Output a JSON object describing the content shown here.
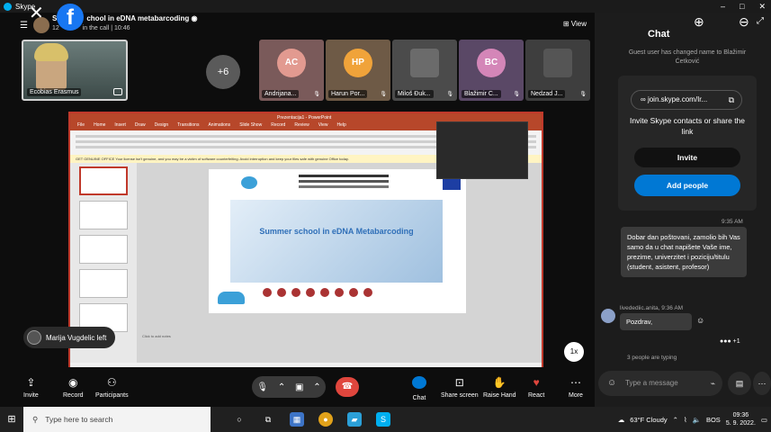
{
  "window": {
    "app_name": "Skype",
    "minimize": "–",
    "maximize": "□",
    "close": "✕"
  },
  "call": {
    "title": "Summer school in eDNA metabarcoding",
    "title_left": "S",
    "title_right": "chool in eDNA metabarcoding",
    "subtitle_left": "12 ",
    "subtitle_right": " in the call | 10:46",
    "view_label": "View",
    "view_icon": "grid-icon"
  },
  "participants": {
    "self_label": "Ecobias Erasmus",
    "more_count": "+6",
    "tiles": [
      {
        "initials": "AC",
        "name": "Andrijana...",
        "color": "#e29a90",
        "bg": "#7a5a5a"
      },
      {
        "initials": "HP",
        "name": "Harun Por...",
        "color": "#f0a33a",
        "bg": "#6e5a46"
      },
      {
        "initials": "",
        "name": "Miloš Đuk...",
        "color": "#6b6b6b",
        "bg": "#4b4b4b"
      },
      {
        "initials": "BC",
        "name": "Blažimir C...",
        "color": "#d486b8",
        "bg": "#5a4866"
      },
      {
        "initials": "",
        "name": "Nedzad J...",
        "color": "#555",
        "bg": "#3e3e3e"
      }
    ]
  },
  "share": {
    "ppt_title": "Prezentacija1 - PowerPoint",
    "ribbon_tabs": [
      "File",
      "Home",
      "Insert",
      "Draw",
      "Design",
      "Transitions",
      "Animations",
      "Slide Show",
      "Record",
      "Review",
      "View",
      "Help"
    ],
    "warning": "GET GENUINE OFFICE  Your license isn't genuine, and you may be a victim of software counterfeiting. Avoid interruption and keep your files safe with genuine Office today.",
    "slide_title": "Summer school in eDNA Metabarcoding",
    "notes": "Click to add notes"
  },
  "notification": {
    "text": "Marija Vugdelic left"
  },
  "speed_badge": "1x",
  "callbar": {
    "invite": "Invite",
    "record": "Record",
    "participants": "Participants",
    "chat": "Chat",
    "share_screen": "Share screen",
    "raise_hand": "Raise Hand",
    "react": "React",
    "more": "More"
  },
  "chat": {
    "title": "Chat",
    "system_message": "Guest user has changed name to Blažimir Ćetković",
    "link": "join.skype.com/Ir...",
    "invite_text": "Invite Skype contacts or share the link",
    "invite_button": "Invite",
    "add_people_button": "Add people",
    "msg1_time": "9:35 AM",
    "msg1_text": "Dobar dan poštovani, zamolio bih Vas samo da u chat napišete Vaše ime, prezime, univerzitet i poziciju/titulu (student, asistent, profesor)",
    "msg2_sender": "livedediic.anita, 9:36 AM",
    "msg2_text": "Pozdrav,",
    "reacts_count": "+1",
    "typing": "3 people are typing",
    "input_placeholder": "Type a message"
  },
  "taskbar": {
    "search_placeholder": "Type here to search",
    "weather": "63°F  Cloudy",
    "lang": "BOS",
    "time": "09:36",
    "date": "5. 9. 2022."
  },
  "colors": {
    "accent": "#0078d4",
    "hangup": "#e0463d",
    "ppt": "#b7472a"
  }
}
